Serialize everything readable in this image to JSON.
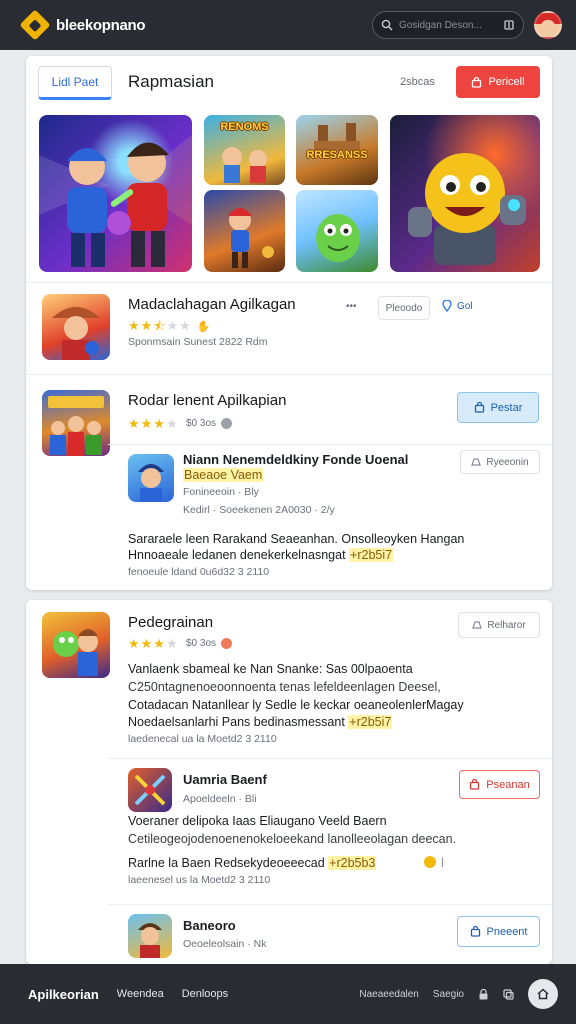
{
  "topbar": {
    "brand": "bleekopnano",
    "search_placeholder": "Gosidgan Deson...",
    "brand_color": "#f0b400"
  },
  "featured": {
    "tab_label": "Lidl Paet",
    "title": "Rapmasian",
    "count": "2sbcas",
    "button_label": "Pericell",
    "tiles": [
      "RENOMS",
      "RRESANSS"
    ]
  },
  "apps": [
    {
      "title": "Madaclahagan Agilkagan",
      "rating": "2.5",
      "meta": "Sponmsain Sunest 2822 Rdm",
      "actions": [
        "Pleoodo",
        "Gol"
      ]
    },
    {
      "title": "Rodar lenent Apilkapian",
      "rating": "3",
      "score": "$0 3os",
      "button_label": "Pestar",
      "sub": {
        "title": "Niann Nenemdeldkiny Fonde Uoenal",
        "highlight": "Baeaoe Vaem",
        "meta": "Fonineeoin · Bly",
        "meta2": "Kedirl · Soeekenen 2A0030 · 2/y",
        "button_label": "Ryeeonin"
      },
      "desc1": "Sararaele leen Rarakand Seaeanhan. Onsolleoyken Hangan",
      "desc2": "Hnnoaeale ledanen denekerkelnasngat",
      "desc_highlight": "+r2b5i7",
      "footer": "fenoeule ldand 0u6d32 3 2110"
    },
    {
      "title": "Pedegrainan",
      "rating": "3",
      "score": "$0 3os",
      "button_label": "Relharor",
      "line1": "Vanlaenk sbameal ke Nan Snanke: Sas 00lpaoenta",
      "line2": "C250ntagnenoeoonnoenta tenas lefeldeenlagen Deesel,",
      "line3": "Cotadacan Natanllear ly Sedle le keckar oeaneolenlerMagay",
      "line4": "Noedaelsanlarhi Pans bedinasmessant",
      "line4_highlight": "+r2b5i7",
      "footer": "laedenecal ua la Moetd2 3 2110",
      "subs": [
        {
          "title": "Uamria Baenf",
          "meta": "Apoeldeeln · Bli",
          "button_label": "Pseanan",
          "line1": "Voeraner delipoka Iaas Eliaugano Veeld Baern",
          "line2": "Cetileogeojodenoenenokeloeekand lanolleeolagan deecan.",
          "line3": "Rarlne la Baen Redsekydeoeeecad",
          "line3_highlight": "+r2b5b3",
          "footer": "laeenesel us la Moetd2 3 2110"
        },
        {
          "title": "Baneoro",
          "meta": "Oeoeleolsain · Nk",
          "button_label": "Pneeent"
        }
      ]
    }
  ],
  "bottombar": {
    "brand": "Apilkeorian",
    "links": [
      "Weendea",
      "Denloops"
    ],
    "right_links": [
      "Naeaeedalen",
      "Saegio"
    ]
  }
}
